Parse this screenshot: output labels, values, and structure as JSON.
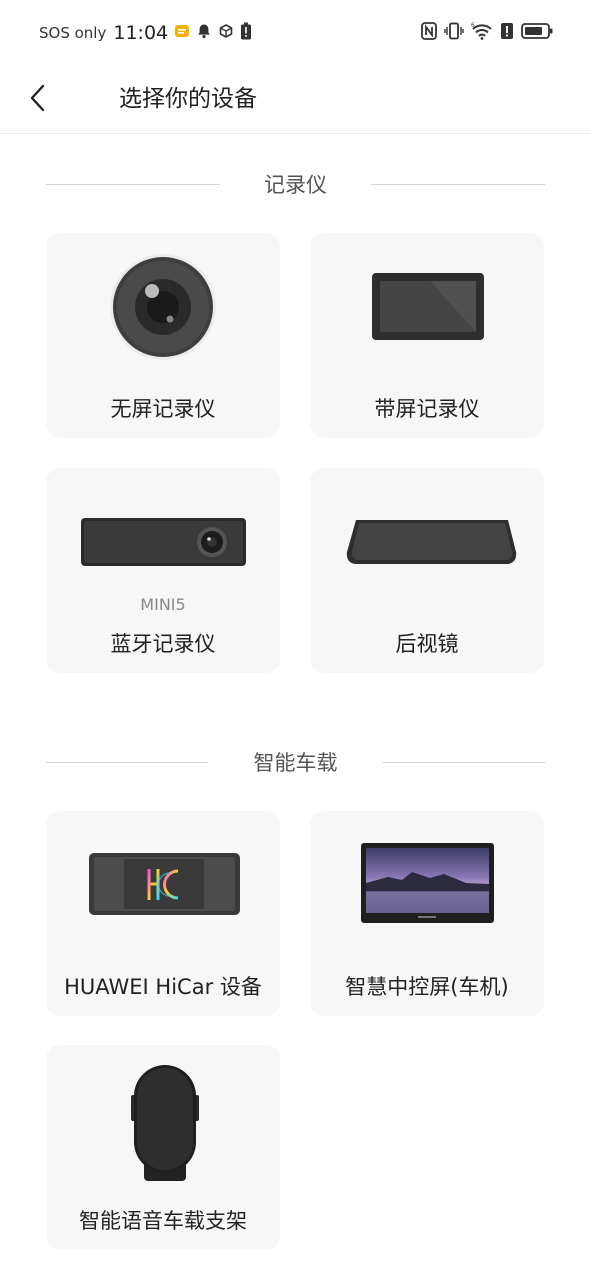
{
  "status": {
    "carrier": "SOS only",
    "time": "11:04"
  },
  "header": {
    "title": "选择你的设备"
  },
  "sections": [
    {
      "label": "记录仪",
      "items": [
        {
          "name": "无屏记录仪",
          "icon": "round-camera-icon"
        },
        {
          "name": "带屏记录仪",
          "icon": "screen-recorder-icon"
        },
        {
          "name": "蓝牙记录仪",
          "sub": "MINI5",
          "icon": "bar-camera-icon"
        },
        {
          "name": "后视镜",
          "icon": "rearview-mirror-icon"
        }
      ]
    },
    {
      "label": "智能车载",
      "items": [
        {
          "name": "HUAWEI HiCar 设备",
          "icon": "hicar-display-icon"
        },
        {
          "name": "智慧中控屏(车机)",
          "icon": "center-console-screen-icon"
        },
        {
          "name": "智能语音车载支架",
          "icon": "phone-holder-icon"
        }
      ]
    }
  ]
}
